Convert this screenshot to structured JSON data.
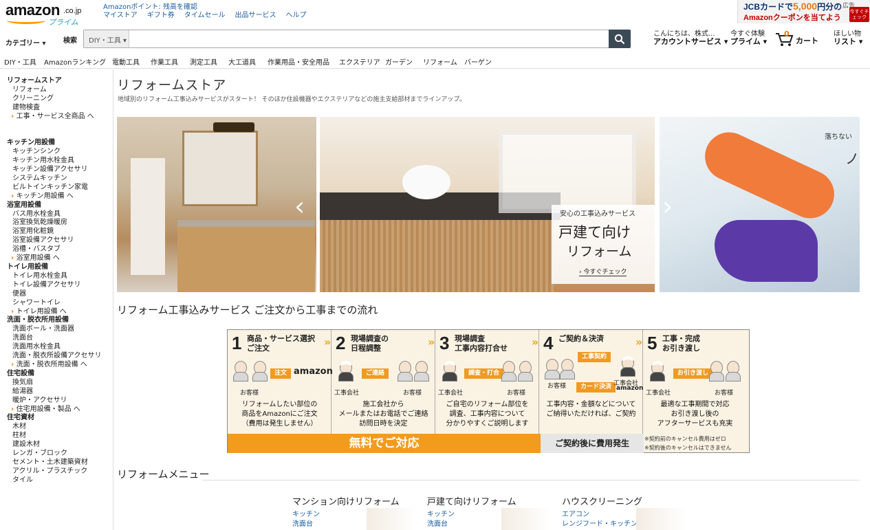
{
  "header": {
    "logo_text": "amazon",
    "logo_suffix": ".co.jp",
    "logo_prime": "プライム",
    "points_link": "Amazonポイント: 残高を確認",
    "top_links": [
      "マイストア",
      "ギフト券",
      "タイムセール",
      "出品サービス",
      "ヘルプ"
    ],
    "promo_line1_a": "JCBカードで",
    "promo_line1_b": "5,000",
    "promo_line1_c": "円分の",
    "promo_line2": "Amazonクーポンを当てよう",
    "promo_ad": "広告",
    "promo_badge": "今すぐチェック",
    "category_label": "カテゴリー",
    "search_label": "検索",
    "search_scope": "DIY・工具",
    "search_value": "",
    "greeting": "こんにちは、株式...",
    "account_label": "アカウントサービス",
    "prime_top": "今すぐ体験",
    "prime_label": "プライム",
    "cart_count": "0",
    "cart_label": "カート",
    "wishlist_top": "ほしい物",
    "wishlist_label": "リスト"
  },
  "subnav": [
    "DIY・工具",
    "Amazonランキング",
    "電動工具",
    "作業工具",
    "測定工具",
    "大工道具",
    "作業用品・安全用品",
    "エクステリア",
    "ガーデン",
    "リフォーム",
    "バーゲン"
  ],
  "sidebar": [
    {
      "type": "h",
      "text": "リフォームストア"
    },
    {
      "type": "i",
      "text": "リフォーム"
    },
    {
      "type": "i",
      "text": "クリーニング"
    },
    {
      "type": "i",
      "text": "建物検査"
    },
    {
      "type": "m",
      "text": "工事・サービス全商品 へ"
    },
    {
      "type": "gap"
    },
    {
      "type": "gap"
    },
    {
      "type": "h",
      "text": "キッチン用設備"
    },
    {
      "type": "i",
      "text": "キッチンシンク"
    },
    {
      "type": "i",
      "text": "キッチン用水栓金具"
    },
    {
      "type": "i",
      "text": "キッチン設備アクセサリ"
    },
    {
      "type": "i",
      "text": "システムキッチン"
    },
    {
      "type": "i",
      "text": "ビルトインキッチン家電"
    },
    {
      "type": "m",
      "text": "キッチン用設備 へ"
    },
    {
      "type": "h",
      "text": "浴室用設備"
    },
    {
      "type": "i",
      "text": "バス用水栓金具"
    },
    {
      "type": "i",
      "text": "浴室換気乾燥暖房"
    },
    {
      "type": "i",
      "text": "浴室用化粧鏡"
    },
    {
      "type": "i",
      "text": "浴室設備アクセサリ"
    },
    {
      "type": "i",
      "text": "浴槽・バスタブ"
    },
    {
      "type": "m",
      "text": "浴室用設備 へ"
    },
    {
      "type": "h",
      "text": "トイレ用設備"
    },
    {
      "type": "i",
      "text": "トイレ用水栓金具"
    },
    {
      "type": "i",
      "text": "トイレ設備アクセサリ"
    },
    {
      "type": "i",
      "text": "便器"
    },
    {
      "type": "i",
      "text": "シャワートイレ"
    },
    {
      "type": "m",
      "text": "トイレ用設備 へ"
    },
    {
      "type": "h",
      "text": "洗面・脱衣所用設備"
    },
    {
      "type": "i",
      "text": "洗面ボール・洗面器"
    },
    {
      "type": "i",
      "text": "洗面台"
    },
    {
      "type": "i",
      "text": "洗面用水栓金具"
    },
    {
      "type": "i",
      "text": "洗面・脱衣所設備アクセサリ"
    },
    {
      "type": "m",
      "text": "洗面・脱衣所用設備 へ"
    },
    {
      "type": "h",
      "text": "住宅設備"
    },
    {
      "type": "i",
      "text": "換気扇"
    },
    {
      "type": "i",
      "text": "給湯器"
    },
    {
      "type": "i",
      "text": "暖炉・アクセサリ"
    },
    {
      "type": "m",
      "text": "住宅用設備・製品 へ"
    },
    {
      "type": "h",
      "text": "住宅資材"
    },
    {
      "type": "i",
      "text": "木材"
    },
    {
      "type": "i",
      "text": "柱材"
    },
    {
      "type": "i",
      "text": "建設木材"
    },
    {
      "type": "i",
      "text": "レンガ・ブロック"
    },
    {
      "type": "i",
      "text": "セメント・土木建築資材"
    },
    {
      "type": "i",
      "text": "アクリル・プラスチック"
    },
    {
      "type": "i",
      "text": "タイル"
    }
  ],
  "main": {
    "title": "リフォームストア",
    "subtitle": "地域別のリフォーム工事込みサービスがスタート！ そのほか住設機器やエクステリアなどの施主支給部材までラインアップ。",
    "carousel": {
      "banner_small": "安心の工事込みサービス",
      "banner_big1": "戸建て向け",
      "banner_big2": "リフォーム",
      "banner_link": "› 今すぐチェック",
      "right_text": "落ちない",
      "right_text2": "ノ"
    },
    "flow_title": "リフォーム工事込みサービス ご注文から工事までの流れ",
    "flow_steps": [
      {
        "num": "1",
        "title": "商品・サービス選択\nご注文",
        "desc": "リフォームしたい部位の\n商品をAmazonにご注文\n（費用は発生しません）"
      },
      {
        "num": "2",
        "title": "現場調査の\n日程調整",
        "desc": "施工会社から\nメールまたはお電話でご連絡\n訪問日時を決定"
      },
      {
        "num": "3",
        "title": "現場調査\n工事内容打合せ",
        "desc": "ご自宅のリフォーム部位を\n調査、工事内容について\n分かりやすくご説明します"
      },
      {
        "num": "4",
        "title": "ご契約＆決済",
        "desc": "工事内容・金額などについて\nご納得いただければ、ご契約"
      },
      {
        "num": "5",
        "title": "工事・完成\nお引き渡し",
        "desc": "最適な工事期間で対応\nお引き渡し後の\nアフターサービスも充実"
      }
    ],
    "flow_tags": [
      "注文",
      "ご連絡",
      "調査・打合",
      "工事契約",
      "カード決済",
      "お引き渡し"
    ],
    "flow_labels": {
      "customer": "お客様",
      "company": "工事会社",
      "amazon": "amazon"
    },
    "flow_free": "無料でご対応",
    "flow_cost": "ご契約後に費用発生",
    "flow_note": "※契約前のキャンセル費用はゼロ\n※契約後のキャンセルはできません",
    "menu_title": "リフォームメニュー",
    "menus": [
      {
        "title": "マンション向けリフォーム",
        "links": [
          "キッチン",
          "洗面台"
        ]
      },
      {
        "title": "戸建て向けリフォーム",
        "links": [
          "キッチン",
          "洗面台"
        ]
      },
      {
        "title": "ハウスクリーニング",
        "links": [
          "エアコン",
          "レンジフード・キッチン"
        ]
      }
    ]
  }
}
